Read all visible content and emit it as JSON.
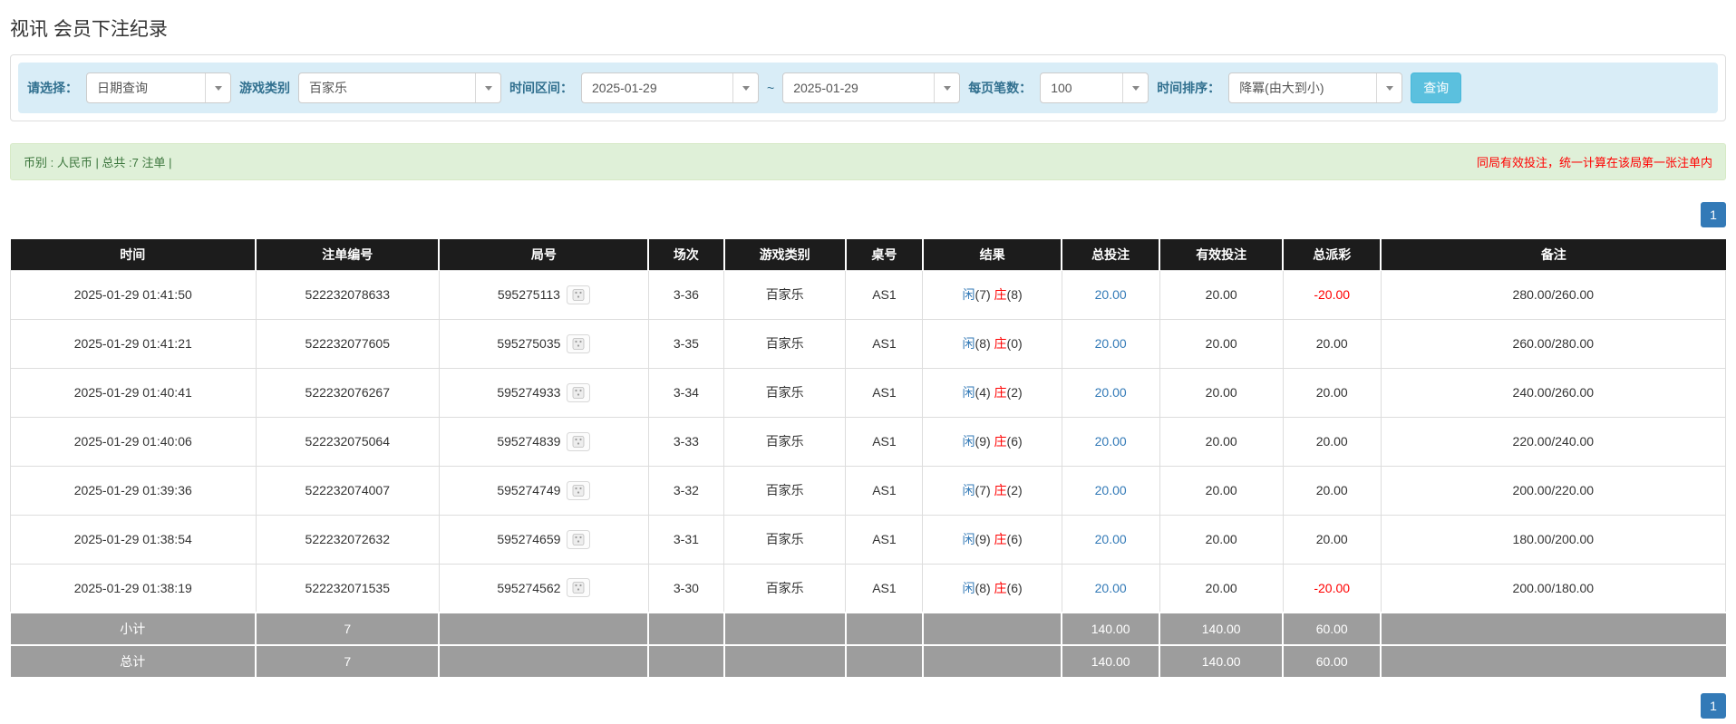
{
  "page_title": "视讯 会员下注纪录",
  "filters": {
    "choose_label": "请选择：",
    "choose_value": "日期查询",
    "game_type_label": "游戏类别",
    "game_type_value": "百家乐",
    "time_range_label": "时间区间：",
    "date_from": "2025-01-29",
    "range_separator": "~",
    "date_to": "2025-01-29",
    "page_size_label": "每页笔数：",
    "page_size_value": "100",
    "sort_label": "时间排序：",
    "sort_value": "降冪(由大到小)",
    "search_button_label": "查询"
  },
  "summary_bar": {
    "left_text": "币别 : 人民币 | 总共 :7 注单 |",
    "right_notice": "同局有效投注，统一计算在该局第一张注单内"
  },
  "pagination": {
    "current_page": "1"
  },
  "colors": {
    "accent_blue": "#337ab7",
    "search_button_blue": "#5bc0de",
    "negative_red": "#ff0000",
    "header_bg": "#1c1c1c",
    "footer_gray": "#9d9d9d",
    "filter_bar_bg": "#d9edf7",
    "summary_bg": "#dff0d8"
  },
  "table": {
    "headers": [
      "时间",
      "注单编号",
      "局号",
      "场次",
      "游戏类别",
      "桌号",
      "结果",
      "总投注",
      "有效投注",
      "总派彩",
      "备注"
    ],
    "rows": [
      {
        "time": "2025-01-29 01:41:50",
        "bet_no": "522232078633",
        "round_no": "595275113",
        "session": "3-36",
        "game_type": "百家乐",
        "table_no": "AS1",
        "player_label": "闲",
        "player_num": "(7)",
        "banker_label": "庄",
        "banker_num": "(8)",
        "total_bet": "20.00",
        "valid_bet": "20.00",
        "payout": "-20.00",
        "remark": "280.00/260.00"
      },
      {
        "time": "2025-01-29 01:41:21",
        "bet_no": "522232077605",
        "round_no": "595275035",
        "session": "3-35",
        "game_type": "百家乐",
        "table_no": "AS1",
        "player_label": "闲",
        "player_num": "(8)",
        "banker_label": "庄",
        "banker_num": "(0)",
        "total_bet": "20.00",
        "valid_bet": "20.00",
        "payout": "20.00",
        "remark": "260.00/280.00"
      },
      {
        "time": "2025-01-29 01:40:41",
        "bet_no": "522232076267",
        "round_no": "595274933",
        "session": "3-34",
        "game_type": "百家乐",
        "table_no": "AS1",
        "player_label": "闲",
        "player_num": "(4)",
        "banker_label": "庄",
        "banker_num": "(2)",
        "total_bet": "20.00",
        "valid_bet": "20.00",
        "payout": "20.00",
        "remark": "240.00/260.00"
      },
      {
        "time": "2025-01-29 01:40:06",
        "bet_no": "522232075064",
        "round_no": "595274839",
        "session": "3-33",
        "game_type": "百家乐",
        "table_no": "AS1",
        "player_label": "闲",
        "player_num": "(9)",
        "banker_label": "庄",
        "banker_num": "(6)",
        "total_bet": "20.00",
        "valid_bet": "20.00",
        "payout": "20.00",
        "remark": "220.00/240.00"
      },
      {
        "time": "2025-01-29 01:39:36",
        "bet_no": "522232074007",
        "round_no": "595274749",
        "session": "3-32",
        "game_type": "百家乐",
        "table_no": "AS1",
        "player_label": "闲",
        "player_num": "(7)",
        "banker_label": "庄",
        "banker_num": "(2)",
        "total_bet": "20.00",
        "valid_bet": "20.00",
        "payout": "20.00",
        "remark": "200.00/220.00"
      },
      {
        "time": "2025-01-29 01:38:54",
        "bet_no": "522232072632",
        "round_no": "595274659",
        "session": "3-31",
        "game_type": "百家乐",
        "table_no": "AS1",
        "player_label": "闲",
        "player_num": "(9)",
        "banker_label": "庄",
        "banker_num": "(6)",
        "total_bet": "20.00",
        "valid_bet": "20.00",
        "payout": "20.00",
        "remark": "180.00/200.00"
      },
      {
        "time": "2025-01-29 01:38:19",
        "bet_no": "522232071535",
        "round_no": "595274562",
        "session": "3-30",
        "game_type": "百家乐",
        "table_no": "AS1",
        "player_label": "闲",
        "player_num": "(8)",
        "banker_label": "庄",
        "banker_num": "(6)",
        "total_bet": "20.00",
        "valid_bet": "20.00",
        "payout": "-20.00",
        "remark": "200.00/180.00"
      }
    ],
    "footer_rows": [
      {
        "label": "小计",
        "count": "7",
        "total_bet": "140.00",
        "valid_bet": "140.00",
        "payout": "60.00"
      },
      {
        "label": "总计",
        "count": "7",
        "total_bet": "140.00",
        "valid_bet": "140.00",
        "payout": "60.00"
      }
    ]
  }
}
